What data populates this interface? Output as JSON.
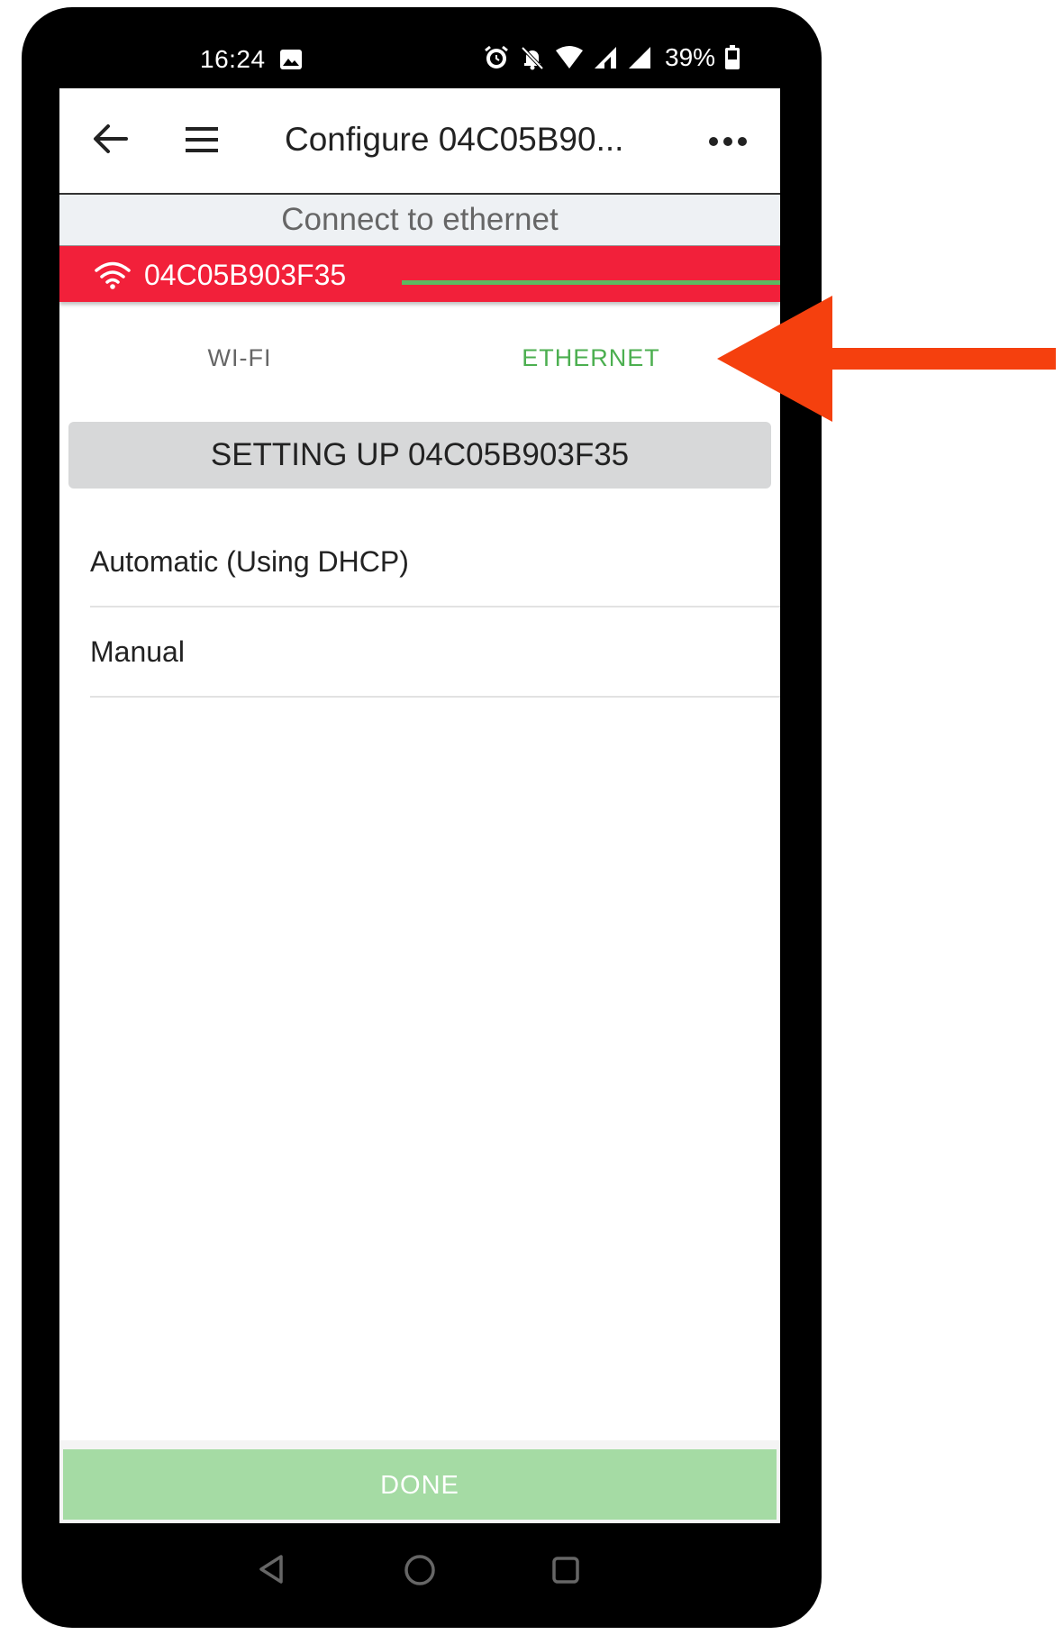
{
  "status_bar": {
    "time": "16:24",
    "battery": "39%",
    "icons": [
      "image-icon",
      "alarm-icon",
      "mute-icon",
      "wifi-icon",
      "signal-icon",
      "signal-icon",
      "battery-icon"
    ]
  },
  "app_bar": {
    "title": "Configure 04C05B90...",
    "icons": [
      "back-arrow-icon",
      "hamburger-menu-icon",
      "more-dots-icon"
    ]
  },
  "sub_header": "Connect to ethernet",
  "device_banner": {
    "name": "04C05B903F35",
    "icon": "wifi-icon",
    "color": "#f2203a"
  },
  "tabs": [
    {
      "label": "WI-FI",
      "active": false
    },
    {
      "label": "ETHERNET",
      "active": true
    }
  ],
  "section_header": "SETTING UP 04C05B903F35",
  "options": [
    {
      "label": "Automatic (Using DHCP)"
    },
    {
      "label": "Manual"
    }
  ],
  "done_button": {
    "label": "DONE",
    "enabled": false,
    "color": "#a5dba4"
  },
  "accent_color": "#4caf50",
  "annotation_arrow": {
    "color": "#f5400e",
    "icon": "pointer-arrow-icon"
  }
}
